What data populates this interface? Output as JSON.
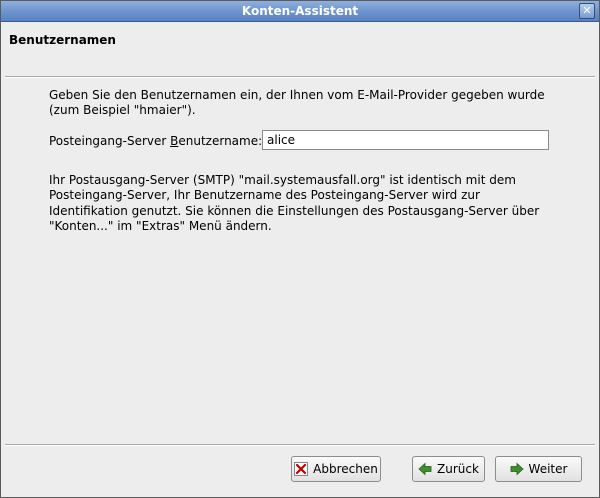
{
  "window": {
    "title": "Konten-Assistent",
    "close_glyph": "✕"
  },
  "header": {
    "title": "Benutzernamen"
  },
  "content": {
    "intro": "Geben Sie den Benutzernamen ein, der Ihnen vom E-Mail-Provider gegeben wurde (zum Beispiel \"hmaier\").",
    "field": {
      "label_before": "Posteingang-Server ",
      "label_mnemonic": "B",
      "label_after": "enutzername:",
      "value": "alice"
    },
    "info": "Ihr Postausgang-Server (SMTP) \"mail.systemausfall.org\" ist identisch mit dem Posteingang-Server, Ihr Benutzername des Posteingang-Server wird zur Identifikation genutzt. Sie können die Einstellungen des Postausgang-Server über \"Konten...\" im \"Extras\" Menü ändern."
  },
  "buttons": {
    "cancel": {
      "label": "Abbrechen",
      "icon": "cancel-x-icon"
    },
    "back": {
      "label": "Zurück",
      "icon": "arrow-left-icon"
    },
    "next": {
      "label": "Weiter",
      "icon": "arrow-right-icon"
    }
  },
  "colors": {
    "titlebar": "#6e95cf",
    "cancel_icon": "#c00000",
    "arrow_icon": "#3f8f2f"
  }
}
